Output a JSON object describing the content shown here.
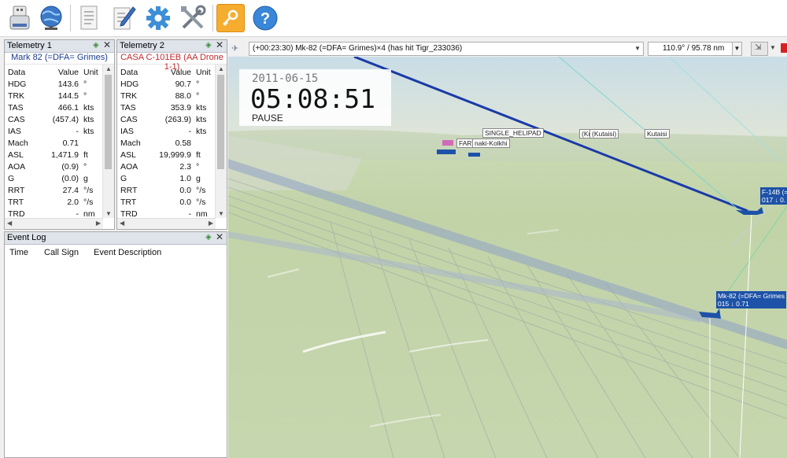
{
  "toolbar": {
    "items": [
      {
        "name": "usb-drive-icon",
        "glyph": "▭"
      },
      {
        "name": "globe-icon",
        "glyph": "🌐"
      },
      {
        "name": "document-icon",
        "glyph": "🗎"
      },
      {
        "name": "edit-icon",
        "glyph": "✎"
      },
      {
        "name": "gear-icon",
        "glyph": "⚙"
      },
      {
        "name": "tools-icon",
        "glyph": "✕"
      },
      {
        "name": "key-icon",
        "glyph": "⚿"
      },
      {
        "name": "help-icon",
        "glyph": "?"
      }
    ]
  },
  "telemetry1": {
    "title": "Telemetry 1",
    "subtitle": "Mark 82 (=DFA= Grimes)",
    "subtitle_color": "#1a3c8c",
    "headers": {
      "data": "Data",
      "value": "Value",
      "unit": "Unit"
    },
    "rows": [
      {
        "data": "HDG",
        "value": "143.6",
        "unit": "°"
      },
      {
        "data": "TRK",
        "value": "144.5",
        "unit": "°"
      },
      {
        "data": "TAS",
        "value": "466.1",
        "unit": "kts"
      },
      {
        "data": "CAS",
        "value": "(457.4)",
        "unit": "kts"
      },
      {
        "data": "IAS",
        "value": "-",
        "unit": "kts"
      },
      {
        "data": "Mach",
        "value": "0.71",
        "unit": ""
      },
      {
        "data": "ASL",
        "value": "1,471.9",
        "unit": "ft"
      },
      {
        "data": "AOA",
        "value": "(0.9)",
        "unit": "°"
      },
      {
        "data": "G",
        "value": "(0.0)",
        "unit": "g"
      },
      {
        "data": "RRT",
        "value": "27.4",
        "unit": "°/s"
      },
      {
        "data": "TRT",
        "value": "2.0",
        "unit": "°/s"
      },
      {
        "data": "TRD",
        "value": "-",
        "unit": "nm"
      }
    ]
  },
  "telemetry2": {
    "title": "Telemetry 2",
    "subtitle": "CASA C-101EB (AA Drone 1-1)",
    "subtitle_color": "#c0282d",
    "headers": {
      "data": "Data",
      "value": "Value",
      "unit": "Unit"
    },
    "rows": [
      {
        "data": "HDG",
        "value": "90.7",
        "unit": "°"
      },
      {
        "data": "TRK",
        "value": "88.0",
        "unit": "°"
      },
      {
        "data": "TAS",
        "value": "353.9",
        "unit": "kts"
      },
      {
        "data": "CAS",
        "value": "(263.9)",
        "unit": "kts"
      },
      {
        "data": "IAS",
        "value": "-",
        "unit": "kts"
      },
      {
        "data": "Mach",
        "value": "0.58",
        "unit": ""
      },
      {
        "data": "ASL",
        "value": "19,999.9",
        "unit": "ft"
      },
      {
        "data": "AOA",
        "value": "2.3",
        "unit": "°"
      },
      {
        "data": "G",
        "value": "1.0",
        "unit": "g"
      },
      {
        "data": "RRT",
        "value": "0.0",
        "unit": "°/s"
      },
      {
        "data": "TRT",
        "value": "0.0",
        "unit": "°/s"
      },
      {
        "data": "TRD",
        "value": "-",
        "unit": "nm"
      }
    ]
  },
  "event_log": {
    "title": "Event Log",
    "headers": {
      "time": "Time",
      "callsign": "Call Sign",
      "description": "Event Description"
    }
  },
  "viewer": {
    "event_combo": "(+00:23:30) Mk-82 (=DFA= Grimes)×4 (has hit Tigr_233036)",
    "bearing_combo": "110.9° / 95.78 nm",
    "hud": {
      "date": "2011-06-15",
      "time": "05:08:51",
      "state": "PAUSE"
    },
    "labels": {
      "helipad": "SINGLE_HELIPAD",
      "farp": "FARP",
      "kolkhi": "naki-Kolkhi",
      "kutaisi_a": "(Ku",
      "kutaisi_b": "(Kutaisi)",
      "kutaisi_c": "Kutaisi"
    },
    "tags": {
      "f14_line1": "F-14B (=",
      "f14_line2": "017 ↓ 0.",
      "mk82_line1": "Mk-82 (=DFA= Grimes",
      "mk82_line2": "015 ↓ 0.71"
    }
  }
}
